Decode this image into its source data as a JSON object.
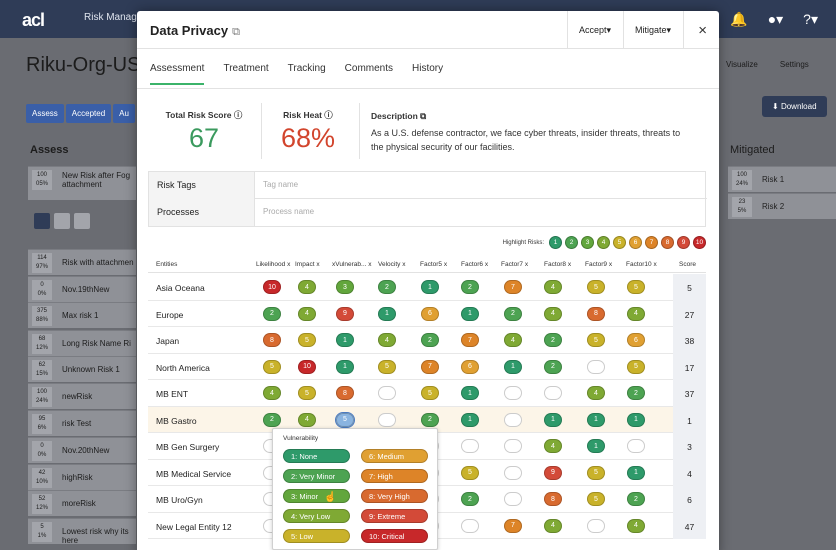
{
  "colors": {
    "1": "#2e9a6a",
    "2": "#4da352",
    "3": "#62a63c",
    "4": "#7fa934",
    "5": "#c9b22a",
    "6": "#e0a032",
    "7": "#dd8428",
    "8": "#d86a2f",
    "9": "#d34a38",
    "10": "#c7282a"
  },
  "app": {
    "logo": "acl",
    "nav": "Risk Manager",
    "org_title": "Riku-Org-US"
  },
  "background": {
    "tabs": [
      "Assess",
      "Accepted",
      "Au"
    ],
    "assess_heading": "Assess",
    "rows": [
      {
        "pct": "100\n05%",
        "name": "New Risk after Fog\nattachment"
      },
      {
        "pct": "114\n97%",
        "name": "Risk with attachmen"
      },
      {
        "pct": "0\n0%",
        "name": "Nov.19thNew"
      },
      {
        "pct": "375\n88%",
        "name": "Max risk 1"
      },
      {
        "pct": "68\n12%",
        "name": "Long Risk Name Ri"
      },
      {
        "pct": "62\n15%",
        "name": "Unknown Risk 1"
      },
      {
        "pct": "100\n24%",
        "name": "newRisk"
      },
      {
        "pct": "95\n6%",
        "name": "risk Test"
      },
      {
        "pct": "0\n0%",
        "name": "Nov.20thNew"
      },
      {
        "pct": "42\n10%",
        "name": "highRisk"
      },
      {
        "pct": "52\n12%",
        "name": "moreRisk"
      },
      {
        "pct": "5\n1%",
        "name": "Lowest risk why its\nhere"
      }
    ],
    "right_nav": [
      "Visualize",
      "Settings"
    ],
    "download_label": "Download",
    "mitigated_heading": "Mitigated",
    "mitigated_rows": [
      {
        "pct": "100\n24%",
        "name": "Risk 1"
      },
      {
        "pct": "23\n5%",
        "name": "Risk 2"
      }
    ]
  },
  "modal": {
    "title": "Data Privacy",
    "accept_label": "Accept",
    "mitigate_label": "Mitigate",
    "close": "×",
    "tabs": [
      "Assessment",
      "Treatment",
      "Tracking",
      "Comments",
      "History"
    ],
    "total_risk_label": "Total Risk Score",
    "total_risk_value": "67",
    "risk_heat_label": "Risk Heat",
    "risk_heat_value": "68%",
    "description_label": "Description",
    "description": "As a U.S. defense contractor, we face cyber threats, insider threats, threats to the physical security of our facilities.",
    "risk_tags_label": "Risk Tags",
    "risk_tags_placeholder": "Tag name",
    "processes_label": "Processes",
    "processes_placeholder": "Process name",
    "highlight_label": "Highlight Risks:",
    "highlight_values": [
      "1",
      "2",
      "3",
      "4",
      "5",
      "6",
      "7",
      "8",
      "9",
      "10"
    ],
    "columns": [
      "Entities",
      "Likelihood",
      "Impact",
      "xVulnerab...",
      "Velocity",
      "Factor5",
      "Factor6",
      "Factor7",
      "Factor8",
      "Factor9",
      "Factor10",
      "Score"
    ],
    "rows": [
      {
        "entity": "Asia Oceana",
        "vals": [
          "10",
          "4",
          "3",
          "2",
          "1",
          "2",
          "7",
          "4",
          "5",
          "5"
        ],
        "score": "5"
      },
      {
        "entity": "Europe",
        "vals": [
          "2",
          "4",
          "9",
          "1",
          "6",
          "1",
          "2",
          "4",
          "8",
          "4"
        ],
        "score": "27"
      },
      {
        "entity": "Japan",
        "vals": [
          "8",
          "5",
          "1",
          "4",
          "2",
          "7",
          "4",
          "2",
          "5",
          "6"
        ],
        "score": "38"
      },
      {
        "entity": "North America",
        "vals": [
          "5",
          "10",
          "1",
          "5",
          "7",
          "6",
          "1",
          "2",
          "",
          "5"
        ],
        "score": "17"
      },
      {
        "entity": "MB ENT",
        "vals": [
          "4",
          "5",
          "8",
          "",
          "5",
          "1",
          "",
          "",
          "4",
          "2"
        ],
        "score": "37"
      },
      {
        "entity": "MB Gastro",
        "vals": [
          "2",
          "4",
          "5",
          "",
          "2",
          "1",
          "",
          "1",
          "1",
          "1"
        ],
        "score": "1"
      },
      {
        "entity": "MB Gen Surgery",
        "vals": [
          "",
          "",
          "",
          "",
          "",
          "",
          "",
          "4",
          "1",
          ""
        ],
        "score": "3"
      },
      {
        "entity": "MB Medical Service",
        "vals": [
          "",
          "",
          "",
          "",
          "",
          "5",
          "",
          "9",
          "5",
          "1"
        ],
        "score": "4"
      },
      {
        "entity": "MB Uro/Gyn",
        "vals": [
          "",
          "",
          "",
          "",
          "",
          "2",
          "",
          "8",
          "5",
          "2"
        ],
        "score": "6"
      },
      {
        "entity": "New Legal Entity 12",
        "vals": [
          "",
          "",
          "",
          "",
          "",
          "",
          "7",
          "4",
          "",
          "4"
        ],
        "score": "47"
      }
    ],
    "popup_title": "Vulnerability",
    "popup_options": [
      {
        "label": "1: None",
        "level": "1"
      },
      {
        "label": "6: Medium",
        "level": "6"
      },
      {
        "label": "2: Very Minor",
        "level": "2"
      },
      {
        "label": "7: High",
        "level": "7"
      },
      {
        "label": "3: Minor",
        "level": "3"
      },
      {
        "label": "8: Very High",
        "level": "8"
      },
      {
        "label": "4: Very Low",
        "level": "4"
      },
      {
        "label": "9: Extreme",
        "level": "9"
      },
      {
        "label": "5: Low",
        "level": "5"
      },
      {
        "label": "10: Critical",
        "level": "10"
      }
    ]
  }
}
